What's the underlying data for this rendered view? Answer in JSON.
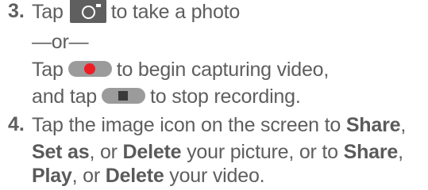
{
  "step3": {
    "number": "3.",
    "tap_word": "Tap",
    "photo_text": "to take a photo",
    "or_text": "—or—",
    "video_tap": "Tap",
    "video_text": "to begin capturing video,",
    "stop_prefix": "and tap",
    "stop_text": "to stop recording."
  },
  "step4": {
    "number": "4.",
    "line1_prefix": "Tap the image icon on the screen to ",
    "line1_bold": "Share",
    "line1_suffix": ",",
    "line2_bold1": "Set as",
    "line2_mid1": ", or ",
    "line2_bold2": "Delete",
    "line2_mid2": " your picture, or to ",
    "line2_bold3": "Share",
    "line2_suffix": ",",
    "line3_bold1": "Play",
    "line3_mid": ", or ",
    "line3_bold2": "Delete",
    "line3_suffix": " your video."
  },
  "icons": {
    "camera": "camera-shutter-icon",
    "record": "record-icon",
    "stop": "stop-icon",
    "record_color": "#ee1c24"
  }
}
